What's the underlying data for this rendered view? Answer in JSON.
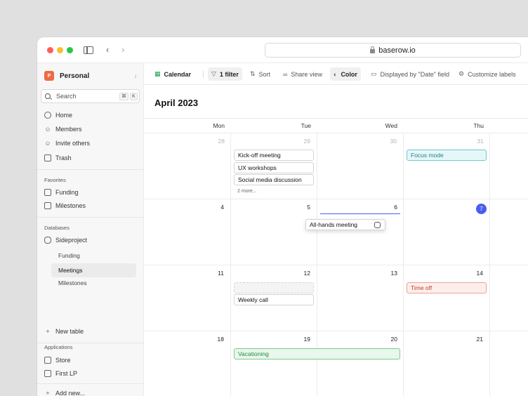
{
  "browser": {
    "url": "baserow.io"
  },
  "sidebar": {
    "workspace": {
      "badge": "P",
      "name": "Personal"
    },
    "search": {
      "placeholder": "Search",
      "shortcut_cmd": "⌘",
      "shortcut_key": "K"
    },
    "main_items": [
      {
        "label": "Home",
        "icon": "home-icon"
      },
      {
        "label": "Members",
        "icon": "members-icon"
      },
      {
        "label": "Invite others",
        "icon": "invite-icon"
      },
      {
        "label": "Trash",
        "icon": "trash-icon"
      }
    ],
    "favorites_heading": "Favorites",
    "favorites": [
      {
        "label": "Funding",
        "icon": "table-icon"
      },
      {
        "label": "Milestones",
        "icon": "calendar-icon"
      }
    ],
    "databases_heading": "Databases",
    "database": {
      "label": "Sideproject",
      "icon": "database-icon"
    },
    "database_tables": [
      "Funding",
      "Meetings",
      "Milestones"
    ],
    "active_table": "Meetings",
    "new_table": "New table",
    "applications_heading": "Applications",
    "applications": [
      {
        "label": "Store",
        "icon": "app-icon"
      },
      {
        "label": "First LP",
        "icon": "app-icon"
      }
    ],
    "add_new": "Add new..."
  },
  "toolbar": {
    "view": "Calendar",
    "filter": "1 filter",
    "sort": "Sort",
    "share": "Share view",
    "color": "Color",
    "displayed": "Displayed by \"Date\" field",
    "customize": "Customize labels"
  },
  "calendar": {
    "month_title": "April 2023",
    "weekdays": [
      "Mon",
      "Tue",
      "Wed",
      "Thu"
    ],
    "weeks": [
      {
        "days": [
          "28",
          "29",
          "30",
          "31"
        ],
        "muted": [
          true,
          true,
          true,
          true
        ]
      },
      {
        "days": [
          "4",
          "5",
          "6",
          "7"
        ],
        "muted": [
          false,
          false,
          false,
          false
        ],
        "today_index": 3
      },
      {
        "days": [
          "11",
          "12",
          "13",
          "14"
        ],
        "muted": [
          false,
          false,
          false,
          false
        ]
      },
      {
        "days": [
          "18",
          "19",
          "20",
          "21"
        ],
        "muted": [
          false,
          false,
          false,
          false
        ]
      }
    ],
    "events": {
      "kickoff": "Kick-off meeting",
      "ux": "UX workshops",
      "social": "Social media discussion",
      "more": "2 more...",
      "focus": "Focus mode",
      "allhands": "All-hands meeting",
      "weekly": "Weekly call",
      "timeoff": "Time off",
      "vacation": "Vacationing"
    },
    "colors": {
      "today": "#4b5cf0",
      "focus": "#23818a",
      "timeoff": "#c0462a",
      "vacation": "#238a3c"
    }
  }
}
